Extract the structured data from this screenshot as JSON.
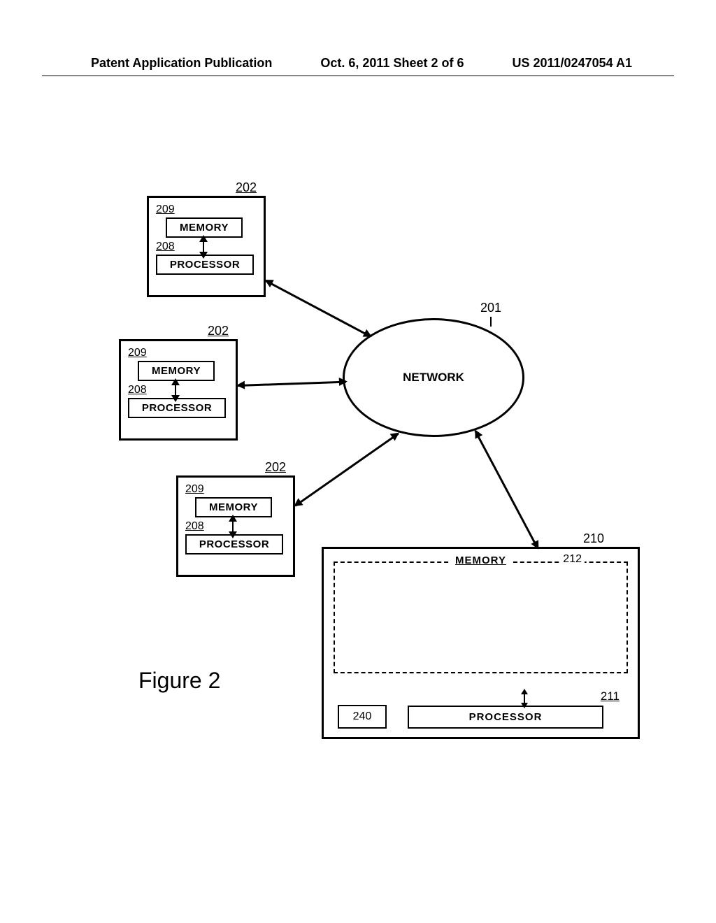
{
  "header": {
    "left": "Patent Application Publication",
    "center": "Oct. 6, 2011  Sheet 2 of 6",
    "right": "US 2011/0247054 A1"
  },
  "refs": {
    "network": "201",
    "client": "202",
    "processor": "208",
    "memory": "209",
    "server": "210",
    "server_processor": "211",
    "server_memory": "212",
    "small": "240"
  },
  "labels": {
    "memory": "MEMORY",
    "processor": "PROCESSOR",
    "network": "NETWORK"
  },
  "caption": "Figure 2"
}
